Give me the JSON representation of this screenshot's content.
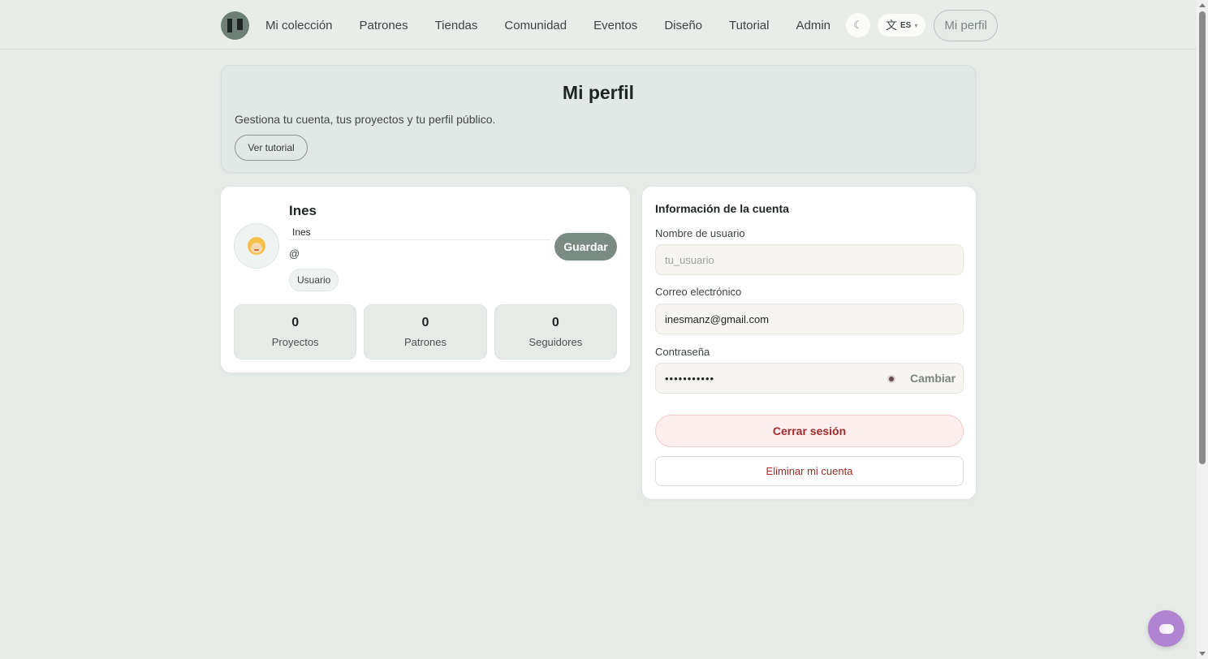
{
  "header": {
    "nav": [
      "Mi colección",
      "Patrones",
      "Tiendas",
      "Comunidad",
      "Eventos",
      "Diseño",
      "Tutorial",
      "Admin"
    ],
    "theme_symbol": "☾",
    "lang_symbol": "文",
    "lang_code": "ES",
    "lang_caret": "▾",
    "profile_label": "Mi perfil"
  },
  "intro": {
    "title": "Mi perfil",
    "subtitle": "Gestiona tu cuenta, tus proyectos y tu perfil público.",
    "tutorial_label": "Ver tutorial"
  },
  "profile": {
    "display_name": "Ines",
    "name_value": "Ines",
    "handle": "@",
    "role": "Usuario",
    "save_label": "Guardar",
    "stats": [
      {
        "value": "0",
        "label": "Proyectos"
      },
      {
        "value": "0",
        "label": "Patrones"
      },
      {
        "value": "0",
        "label": "Seguidores"
      }
    ]
  },
  "account": {
    "title": "Información de la cuenta",
    "username_label": "Nombre de usuario",
    "username_placeholder": "tu_usuario",
    "email_label": "Correo electrónico",
    "email_value": "inesmanz@gmail.com",
    "password_label": "Contraseña",
    "password_value": "•••••••••••",
    "change_label": "Cambiar",
    "logout_label": "Cerrar sesión",
    "delete_label": "Eliminar mi cuenta"
  },
  "icons": {
    "logo": "logo-icon",
    "theme": "moon-icon",
    "lang": "language-icon",
    "avatar": "avatar-emoji-icon",
    "eye": "eye-icon",
    "chat": "chat-icon"
  },
  "colors": {
    "accent": "#7a8b83",
    "danger": "#a12a2a",
    "chat": "#b084d1"
  }
}
